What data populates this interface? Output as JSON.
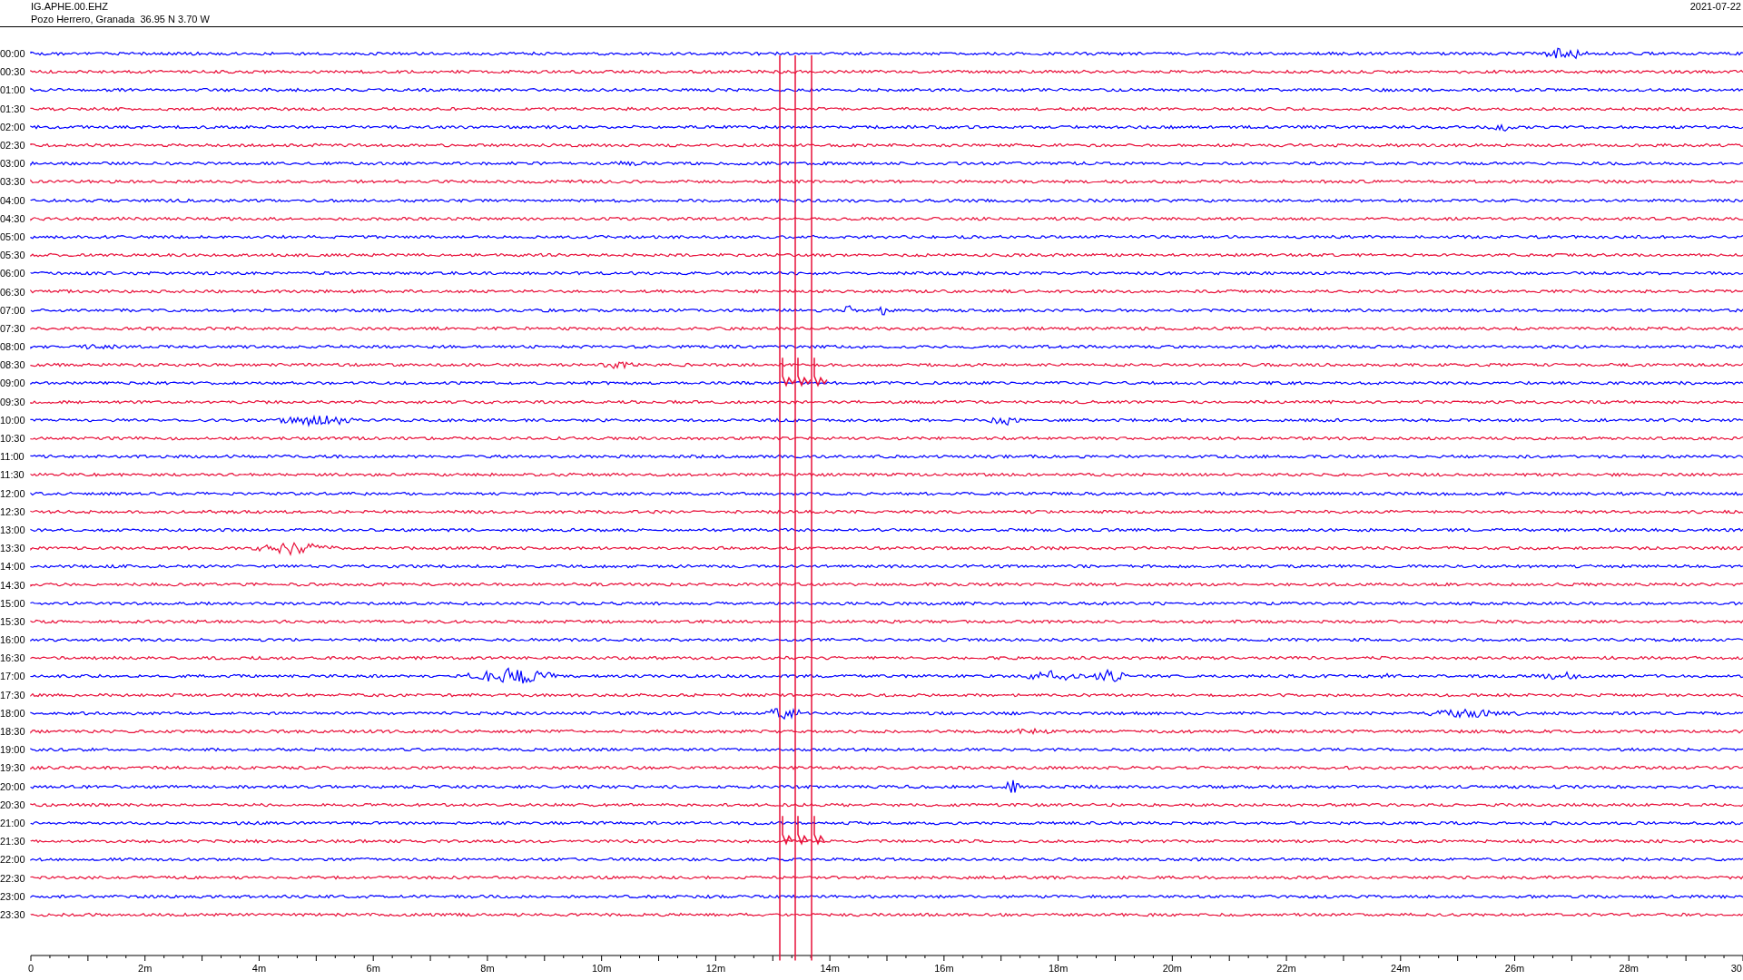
{
  "header": {
    "station": "IG.APHE.00.EHZ",
    "location": "Pozo Herrero, Granada  36.95 N 3.70 W",
    "date": "2021-07-22"
  },
  "rows": [
    {
      "label": "00:00",
      "color": "#0000ff"
    },
    {
      "label": "00:30",
      "color": "#e8103a"
    },
    {
      "label": "01:00",
      "color": "#0000ff"
    },
    {
      "label": "01:30",
      "color": "#e8103a"
    },
    {
      "label": "02:00",
      "color": "#0000ff"
    },
    {
      "label": "02:30",
      "color": "#e8103a"
    },
    {
      "label": "03:00",
      "color": "#0000ff"
    },
    {
      "label": "03:30",
      "color": "#e8103a"
    },
    {
      "label": "04:00",
      "color": "#0000ff"
    },
    {
      "label": "04:30",
      "color": "#e8103a"
    },
    {
      "label": "05:00",
      "color": "#0000ff"
    },
    {
      "label": "05:30",
      "color": "#e8103a"
    },
    {
      "label": "06:00",
      "color": "#0000ff"
    },
    {
      "label": "06:30",
      "color": "#e8103a"
    },
    {
      "label": "07:00",
      "color": "#0000ff"
    },
    {
      "label": "07:30",
      "color": "#e8103a"
    },
    {
      "label": "08:00",
      "color": "#0000ff"
    },
    {
      "label": "08:30",
      "color": "#e8103a"
    },
    {
      "label": "09:00",
      "color": "#0000ff"
    },
    {
      "label": "09:30",
      "color": "#e8103a"
    },
    {
      "label": "10:00",
      "color": "#0000ff"
    },
    {
      "label": "10:30",
      "color": "#e8103a"
    },
    {
      "label": "11:00",
      "color": "#0000ff"
    },
    {
      "label": "11:30",
      "color": "#e8103a"
    },
    {
      "label": "12:00",
      "color": "#0000ff"
    },
    {
      "label": "12:30",
      "color": "#e8103a"
    },
    {
      "label": "13:00",
      "color": "#0000ff"
    },
    {
      "label": "13:30",
      "color": "#e8103a"
    },
    {
      "label": "14:00",
      "color": "#0000ff"
    },
    {
      "label": "14:30",
      "color": "#e8103a"
    },
    {
      "label": "15:00",
      "color": "#0000ff"
    },
    {
      "label": "15:30",
      "color": "#e8103a"
    },
    {
      "label": "16:00",
      "color": "#0000ff"
    },
    {
      "label": "16:30",
      "color": "#e8103a"
    },
    {
      "label": "17:00",
      "color": "#0000ff"
    },
    {
      "label": "17:30",
      "color": "#e8103a"
    },
    {
      "label": "18:00",
      "color": "#0000ff"
    },
    {
      "label": "18:30",
      "color": "#e8103a"
    },
    {
      "label": "19:00",
      "color": "#0000ff"
    },
    {
      "label": "19:30",
      "color": "#e8103a"
    },
    {
      "label": "20:00",
      "color": "#0000ff"
    },
    {
      "label": "20:30",
      "color": "#e8103a"
    },
    {
      "label": "21:00",
      "color": "#0000ff"
    },
    {
      "label": "21:30",
      "color": "#e8103a"
    },
    {
      "label": "22:00",
      "color": "#0000ff"
    },
    {
      "label": "22:30",
      "color": "#e8103a"
    },
    {
      "label": "23:00",
      "color": "#0000ff"
    },
    {
      "label": "23:30",
      "color": "#e8103a"
    }
  ],
  "axis": {
    "tick_labels": [
      "0",
      "2m",
      "4m",
      "6m",
      "8m",
      "10m",
      "12m",
      "14m",
      "16m",
      "18m",
      "20m",
      "22m",
      "24m",
      "26m",
      "28m",
      "30"
    ]
  }
}
